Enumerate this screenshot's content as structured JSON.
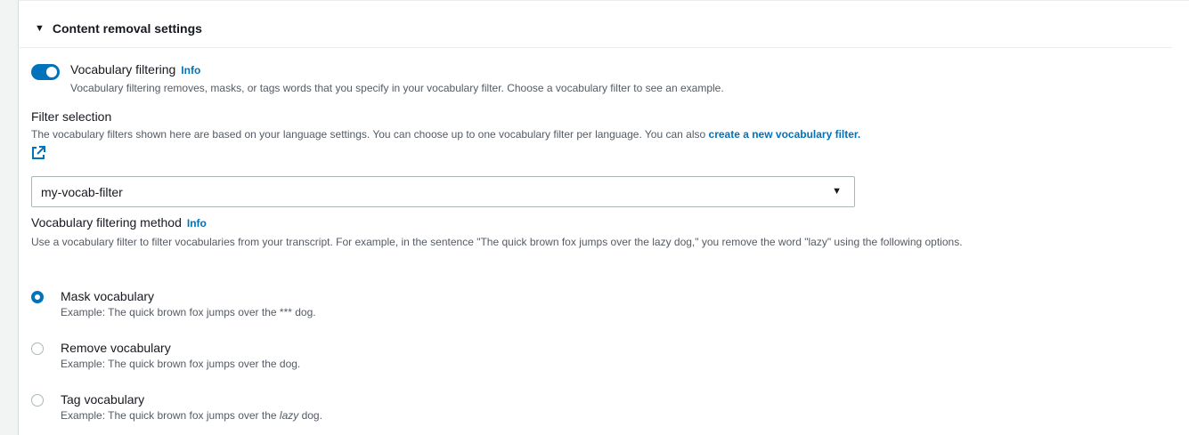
{
  "section": {
    "title": "Content removal settings"
  },
  "vocab_filtering": {
    "label": "Vocabulary filtering",
    "info": "Info",
    "description": "Vocabulary filtering removes, masks, or tags words that you specify in your vocabulary filter. Choose a vocabulary filter to see an example.",
    "enabled": true
  },
  "filter_selection": {
    "label": "Filter selection",
    "description": "The vocabulary filters shown here are based on your language settings. You can choose up to one vocabulary filter per language. You can also ",
    "link": "create a new vocabulary filter.",
    "selected": "my-vocab-filter"
  },
  "method": {
    "label": "Vocabulary filtering method",
    "info": "Info",
    "description": "Use a vocabulary filter to filter vocabularies from your transcript. For example, in the sentence \"The quick brown fox jumps over the lazy dog,\" you remove the word \"lazy\" using the following options.",
    "options": [
      {
        "title": "Mask vocabulary",
        "example": "Example: The quick brown fox jumps over the *** dog.",
        "checked": true
      },
      {
        "title": "Remove vocabulary",
        "example": "Example: The quick brown fox jumps over the dog.",
        "checked": false
      },
      {
        "title": "Tag vocabulary",
        "example_pre": "Example: The quick brown fox jumps over the ",
        "example_em": "lazy",
        "example_post": " dog.",
        "checked": false
      }
    ]
  },
  "colors": {
    "accent": "#0073bb",
    "text": "#16191f",
    "muted": "#545b64"
  }
}
